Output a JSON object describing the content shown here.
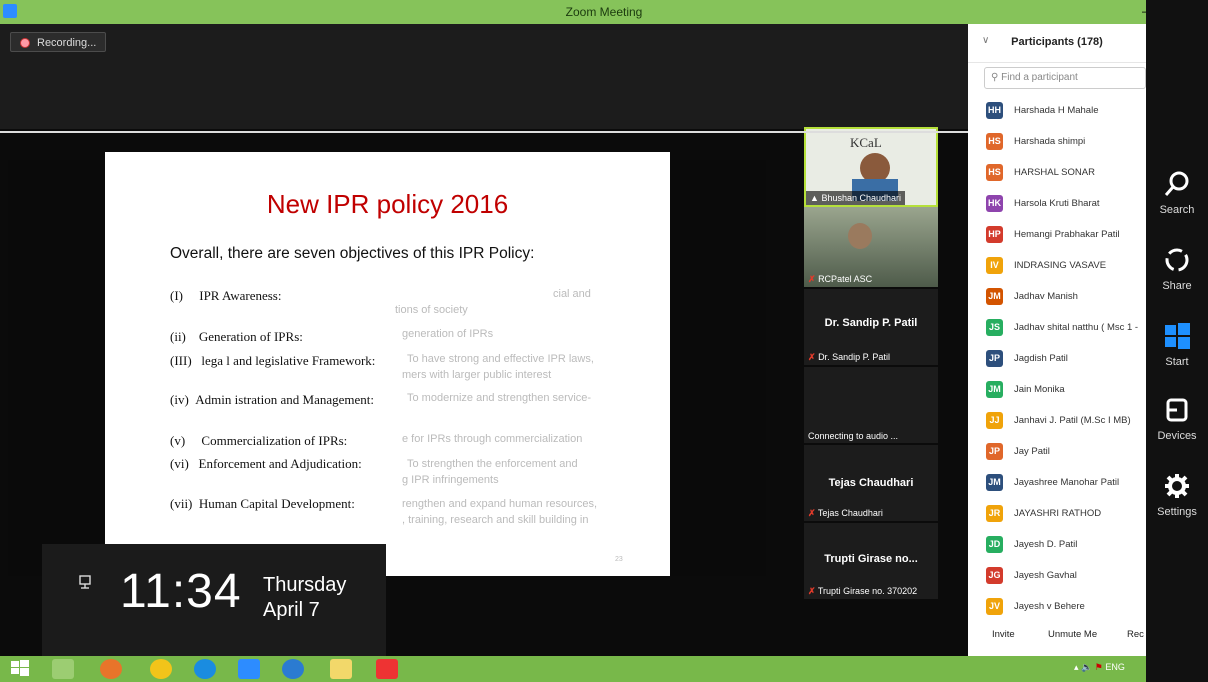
{
  "window": {
    "title": "Zoom Meeting"
  },
  "recording": {
    "label": "Recording..."
  },
  "slide": {
    "title": "New IPR policy 2016",
    "intro": "Overall, there are seven objectives of this IPR Policy:",
    "objectives": [
      {
        "num": "(I)",
        "label": "IPR Awareness:"
      },
      {
        "num": "(ii)",
        "label": "Generation of IPRs:"
      },
      {
        "num": "(III)",
        "label": "lega l  and  legislative  Framework:"
      },
      {
        "num": "(iv)",
        "label": "Admin istration and Management:"
      },
      {
        "num": "(v)",
        "label": "Commercialization of IPRs:"
      },
      {
        "num": "(vi)",
        "label": "Enforcement and Adjudication:"
      },
      {
        "num": "(vii)",
        "label": "Human Capital Development:"
      }
    ],
    "faded_lines": [
      "cial and",
      "tions of society",
      "generation of IPRs",
      "To have strong and effective IPR laws,",
      "mers with larger public interest",
      "To modernize and strengthen service-",
      "e for IPRs through commercialization",
      "To  strengthen  the  enforcement  and",
      "g IPR infringements",
      "rengthen and expand human resources,",
      ", training, research and skill building in"
    ],
    "page_number": "23"
  },
  "clock": {
    "time": "11:34",
    "day": "Thursday",
    "date": "April 7"
  },
  "videos": [
    {
      "name": "Bhushan Chaudhari",
      "logo_text": "KCaL",
      "kind": "active"
    },
    {
      "name": "RCPatel ASC",
      "kind": "video"
    },
    {
      "center_name": "Dr. Sandip P. Patil",
      "name": "Dr. Sandip P. Patil",
      "kind": "muted"
    },
    {
      "name": "Connecting to audio ...",
      "kind": "blank"
    },
    {
      "center_name": "Tejas Chaudhari",
      "name": "Tejas Chaudhari",
      "kind": "muted"
    },
    {
      "center_name": "Trupti Girase no...",
      "name": "Trupti Girase no. 370202",
      "kind": "muted"
    }
  ],
  "participants": {
    "title": "Participants (178)",
    "search_placeholder": "Find a participant",
    "items": [
      {
        "initials": "HH",
        "name": "Harshada H Mahale",
        "color": "#2d4f7c"
      },
      {
        "initials": "HS",
        "name": "Harshada shimpi",
        "color": "#e0672a"
      },
      {
        "initials": "HS",
        "name": "HARSHAL SONAR",
        "color": "#e0672a"
      },
      {
        "initials": "HK",
        "name": "Harsola Kruti Bharat",
        "color": "#8e44ad"
      },
      {
        "initials": "HP",
        "name": "Hemangi Prabhakar Patil",
        "color": "#d33b2c"
      },
      {
        "initials": "IV",
        "name": "INDRASING VASAVE",
        "color": "#f0a30a"
      },
      {
        "initials": "JM",
        "name": "Jadhav Manish",
        "color": "#d35400"
      },
      {
        "initials": "JS",
        "name": "Jadhav shital natthu ( Msc 1 -",
        "color": "#27ae60"
      },
      {
        "initials": "JP",
        "name": "Jagdish Patil",
        "color": "#2d4f7c"
      },
      {
        "initials": "JM",
        "name": "Jain Monika",
        "color": "#27ae60"
      },
      {
        "initials": "JJ",
        "name": "Janhavi J. Patil (M.Sc I MB)",
        "color": "#f0a30a"
      },
      {
        "initials": "JP",
        "name": "Jay Patil",
        "color": "#e0672a"
      },
      {
        "initials": "JM",
        "name": "Jayashree Manohar Patil",
        "color": "#2d4f7c"
      },
      {
        "initials": "JR",
        "name": "JAYASHRI RATHOD",
        "color": "#f0a30a"
      },
      {
        "initials": "JD",
        "name": "Jayesh D. Patil",
        "color": "#27ae60"
      },
      {
        "initials": "JG",
        "name": "Jayesh Gavhal",
        "color": "#d33b2c"
      },
      {
        "initials": "JV",
        "name": "Jayesh v Behere",
        "color": "#f0a30a"
      }
    ],
    "footer": {
      "invite": "Invite",
      "unmute": "Unmute Me",
      "record": "Rec"
    }
  },
  "charms": [
    {
      "label": "Search",
      "icon": "search-icon"
    },
    {
      "label": "Share",
      "icon": "share-icon"
    },
    {
      "label": "Start",
      "icon": "windows-icon"
    },
    {
      "label": "Devices",
      "icon": "devices-icon"
    },
    {
      "label": "Settings",
      "icon": "gear-icon"
    }
  ],
  "taskbar": {
    "tray_text": "ENG"
  }
}
